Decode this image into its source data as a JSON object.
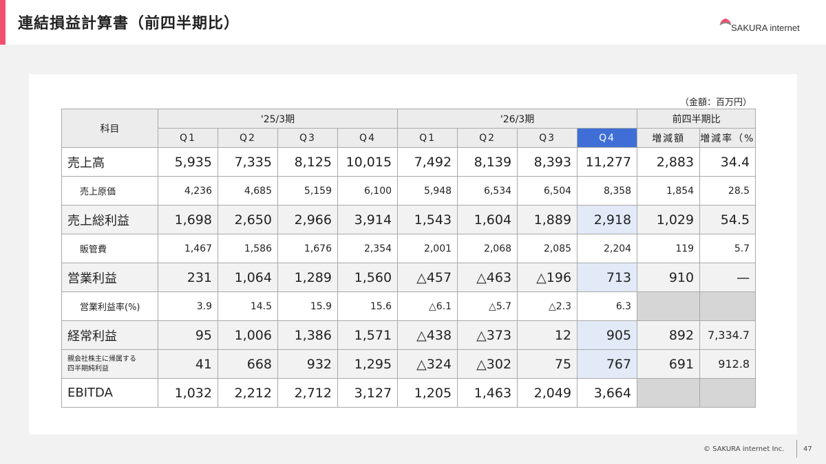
{
  "header": {
    "title": "連結損益計算書（前四半期比）",
    "logo_text": "SAKURA internet"
  },
  "unit_note": "（金額：百万円）",
  "table": {
    "item_header": "科目",
    "fy25_label": "'25/3期",
    "fy26_label": "'26/3期",
    "diff_label": "前四半期比",
    "quarters": [
      "Q1",
      "Q2",
      "Q3",
      "Q4"
    ],
    "diff_amount_label": "増減額",
    "diff_rate_label": "増減率",
    "diff_rate_unit": "（%）",
    "rows": [
      {
        "label": "売上高",
        "kind": "major",
        "values": [
          "5,935",
          "7,335",
          "8,125",
          "10,015",
          "7,492",
          "8,139",
          "8,393",
          "11,277",
          "2,883",
          "34.4"
        ]
      },
      {
        "label": "売上原価",
        "kind": "minor",
        "values": [
          "4,236",
          "4,685",
          "5,159",
          "6,100",
          "5,948",
          "6,534",
          "6,504",
          "8,358",
          "1,854",
          "28.5"
        ]
      },
      {
        "label": "売上総利益",
        "kind": "major",
        "values": [
          "1,698",
          "2,650",
          "2,966",
          "3,914",
          "1,543",
          "1,604",
          "1,889",
          "2,918",
          "1,029",
          "54.5"
        ]
      },
      {
        "label": "販管費",
        "kind": "minor",
        "values": [
          "1,467",
          "1,586",
          "1,676",
          "2,354",
          "2,001",
          "2,068",
          "2,085",
          "2,204",
          "119",
          "5.7"
        ]
      },
      {
        "label": "営業利益",
        "kind": "major",
        "values": [
          "231",
          "1,064",
          "1,289",
          "1,560",
          "△457",
          "△463",
          "△196",
          "713",
          "910",
          "—"
        ]
      },
      {
        "label": "営業利益率(%)",
        "kind": "minor",
        "values": [
          "3.9",
          "14.5",
          "15.9",
          "15.6",
          "△6.1",
          "△5.7",
          "△2.3",
          "6.3",
          "",
          ""
        ]
      },
      {
        "label": "経常利益",
        "kind": "major",
        "values": [
          "95",
          "1,006",
          "1,386",
          "1,571",
          "△438",
          "△373",
          "12",
          "905",
          "892",
          "7,334.7"
        ]
      },
      {
        "label_line1": "親会社株主に帰属する",
        "label_line2": "四半期純利益",
        "kind": "major",
        "values": [
          "41",
          "668",
          "932",
          "1,295",
          "△324",
          "△302",
          "75",
          "767",
          "691",
          "912.8"
        ]
      },
      {
        "label": "EBITDA",
        "kind": "major",
        "values": [
          "1,032",
          "2,212",
          "2,712",
          "3,127",
          "1,205",
          "1,463",
          "2,049",
          "3,664",
          "",
          ""
        ]
      }
    ]
  },
  "footer": {
    "copyright": "© SAKURA internet Inc.",
    "page": "47"
  },
  "colors": {
    "accent": "#f0506e",
    "highlight": "#3f6fd6",
    "highlight_light": "#e2eaf8"
  }
}
